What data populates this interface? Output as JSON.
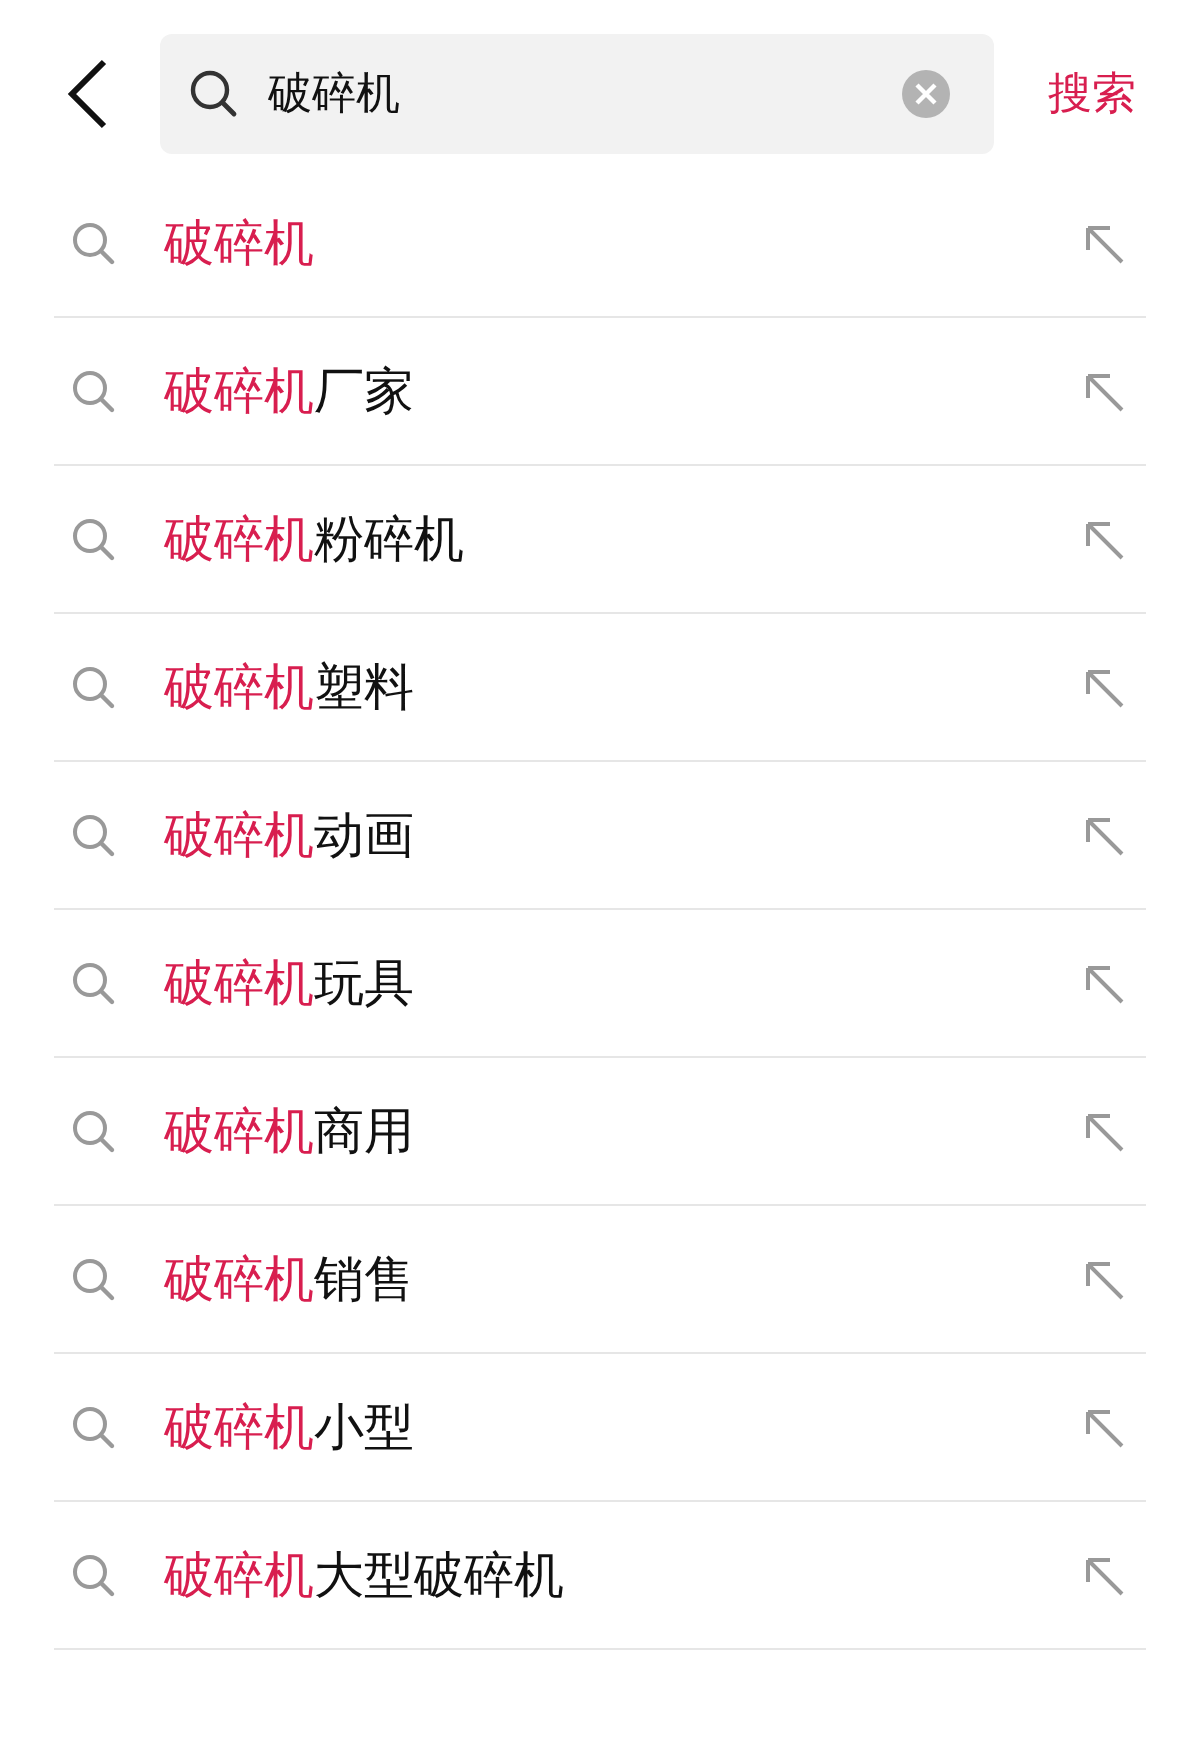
{
  "search": {
    "value": "破碎机",
    "action": "搜索"
  },
  "suggestions": [
    {
      "highlight": "破碎机"
    },
    {
      "highlight": "破碎机",
      "rest": "厂家"
    },
    {
      "highlight": "破碎机",
      "rest": "粉碎机"
    },
    {
      "highlight": "破碎机",
      "rest": "塑料"
    },
    {
      "highlight": "破碎机",
      "rest": "动画"
    },
    {
      "highlight": "破碎机",
      "rest": "玩具"
    },
    {
      "highlight": "破碎机",
      "rest": "商用"
    },
    {
      "highlight": "破碎机",
      "rest": "销售"
    },
    {
      "highlight": "破碎机",
      "rest": "小型"
    },
    {
      "highlight": "破碎机",
      "rest": "大型破碎机"
    }
  ]
}
